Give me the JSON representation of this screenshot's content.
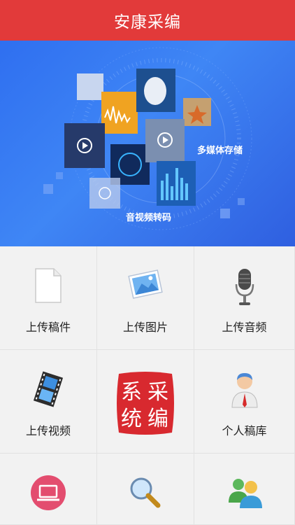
{
  "header": {
    "title": "安康采编"
  },
  "banner": {
    "label_storage": "多媒体存储",
    "label_transcode": "音视频转码",
    "colors": {
      "bg_start": "#2f6ff0",
      "bg_end": "#2f5fe0"
    }
  },
  "grid": {
    "items": [
      {
        "label": "上传稿件",
        "icon": "document-icon"
      },
      {
        "label": "上传图片",
        "icon": "image-icon"
      },
      {
        "label": "上传音频",
        "icon": "microphone-icon"
      },
      {
        "label": "上传视频",
        "icon": "film-icon"
      },
      {
        "label": "",
        "icon": "caibian-seal-logo",
        "seal_text": "采编系统"
      },
      {
        "label": "个人稿库",
        "icon": "user-icon"
      },
      {
        "label": "",
        "icon": "laptop-icon"
      },
      {
        "label": "",
        "icon": "search-icon"
      },
      {
        "label": "",
        "icon": "users-icon"
      }
    ]
  },
  "colors": {
    "header": "#e23a3a",
    "seal": "#d8292f"
  }
}
